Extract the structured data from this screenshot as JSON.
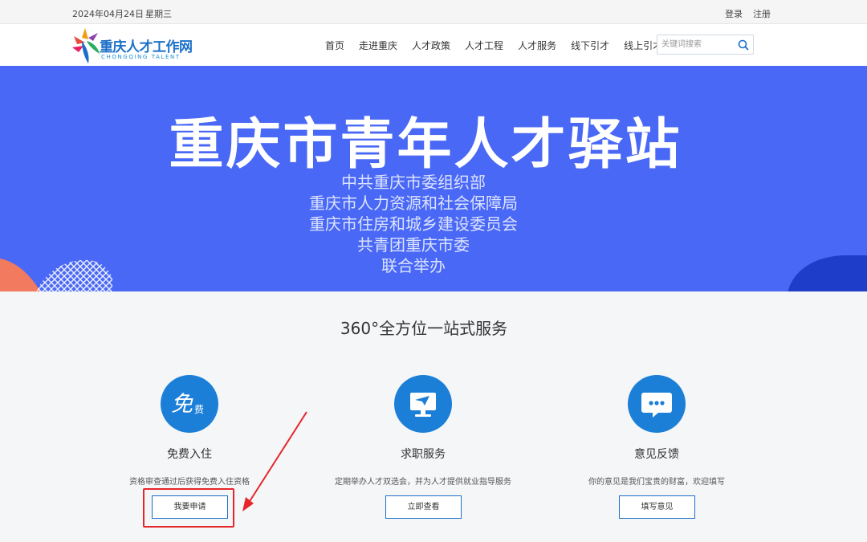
{
  "topbar": {
    "date": "2024年04月24日",
    "weekday": "星期三",
    "login": "登录",
    "register": "注册"
  },
  "header": {
    "logo_title": "重庆人才工作网",
    "logo_subtitle": "CHONGQING TALENT",
    "nav": [
      "首页",
      "走进重庆",
      "人才政策",
      "人才工程",
      "人才服务",
      "线下引才",
      "线上引才"
    ],
    "search_placeholder": "关键词搜索",
    "search_icon": "search-icon"
  },
  "banner": {
    "title": "重庆市青年人才驿站",
    "lines": [
      "中共重庆市委组织部",
      "重庆市人力资源和社会保障局",
      "重庆市住房和城乡建设委员会",
      "共青团重庆市委",
      "联合举办"
    ],
    "background_color": "#4a68f6"
  },
  "services": {
    "title": "360°全方位一站式服务",
    "cards": [
      {
        "icon": "free-icon",
        "icon_text_main": "免",
        "icon_text_sub": "费",
        "name": "免费入住",
        "desc": "资格审查通过后获得免费入住资格",
        "button": "我要申请"
      },
      {
        "icon": "monitor-send-icon",
        "name": "求职服务",
        "desc": "定期举办人才双选会，并为人才提供就业指导服务",
        "button": "立即查看"
      },
      {
        "icon": "chat-bubble-icon",
        "name": "意见反馈",
        "desc": "你的意见是我们宝贵的财富，欢迎填写",
        "button": "填写意见"
      }
    ]
  },
  "colors": {
    "accent": "#1b7fd8",
    "highlight": "#e5262b"
  }
}
